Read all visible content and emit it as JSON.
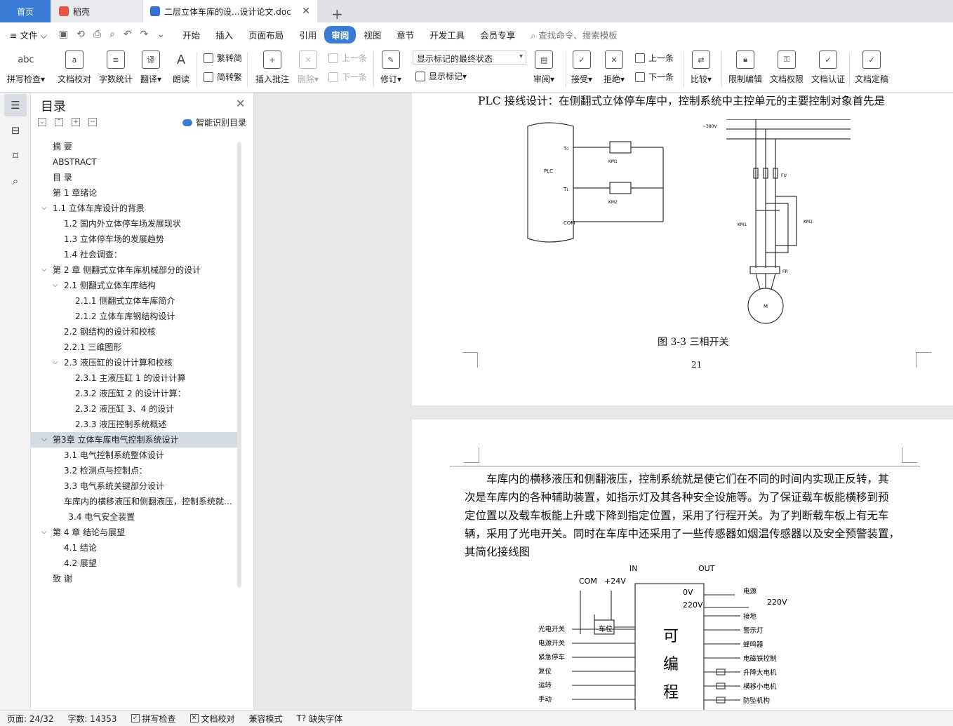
{
  "tabs": {
    "home": "首页",
    "daoke": "稻壳",
    "doc": "二层立体车库的设...设计论文.doc"
  },
  "menubar": {
    "file": "文件",
    "items": [
      "开始",
      "插入",
      "页面布局",
      "引用",
      "审阅",
      "视图",
      "章节",
      "开发工具",
      "会员专享"
    ],
    "active": "审阅",
    "search_placeholder": "查找命令、搜索模板"
  },
  "ribbon": {
    "spell": "拼写检查",
    "proof": "文档校对",
    "wordcount": "字数统计",
    "translate": "翻译",
    "read": "朗读",
    "trad": "繁转简",
    "simp": "简转繁",
    "comment": "插入批注",
    "delete": "删除",
    "prev1": "上一条",
    "next1": "下一条",
    "revise": "修订",
    "markup_select": "显示标记的最终状态",
    "show_markup": "显示标记",
    "review": "审阅",
    "accept": "接受",
    "reject": "拒绝",
    "prev2": "上一条",
    "next2": "下一条",
    "compare": "比较",
    "restrict": "限制编辑",
    "perm": "文档权限",
    "cert": "文档认证",
    "final": "文档定稿",
    "abc": "abc"
  },
  "nav": {
    "title": "目录",
    "smart": "智能识别目录",
    "items": [
      {
        "text": "摘  要",
        "level": 0,
        "chev": ""
      },
      {
        "text": "ABSTRACT",
        "level": 0,
        "chev": ""
      },
      {
        "text": "目   录",
        "level": 0,
        "chev": ""
      },
      {
        "text": "第 1 章绪论",
        "level": 0,
        "chev": ""
      },
      {
        "text": "1.1  立体车库设计的背景",
        "level": 0,
        "chev": "v"
      },
      {
        "text": "1.2  国内外立体停车场发展现状",
        "level": 1,
        "chev": ""
      },
      {
        "text": "1.3  立体停车场的发展趋势",
        "level": 1,
        "chev": ""
      },
      {
        "text": "1.4  社会调查：",
        "level": 1,
        "chev": ""
      },
      {
        "text": "第 2 章  侧翻式立体车库机械部分的设计",
        "level": 0,
        "chev": "v"
      },
      {
        "text": "2.1  侧翻式立体车库结构",
        "level": 1,
        "chev": "v"
      },
      {
        "text": "2.1.1  侧翻式立体车库简介",
        "level": 2,
        "chev": ""
      },
      {
        "text": "2.1.2    立体车库钢结构设计",
        "level": 2,
        "chev": ""
      },
      {
        "text": "2.2  钢结构的设计和校核",
        "level": 1,
        "chev": ""
      },
      {
        "text": "2.2.1  三维图形",
        "level": 1,
        "chev": ""
      },
      {
        "text": "2.3  液压缸的设计计算和校核",
        "level": 1,
        "chev": "v"
      },
      {
        "text": "2.3.1 主液压缸 1 的设计计算",
        "level": 2,
        "chev": ""
      },
      {
        "text": "2.3.2 液压缸 2 的设计计算：",
        "level": 2,
        "chev": ""
      },
      {
        "text": "2.3.2  液压缸 3、4 的设计",
        "level": 2,
        "chev": ""
      },
      {
        "text": "2.3.3  液压控制系统概述",
        "level": 2,
        "chev": ""
      },
      {
        "text": "第3章  立体车库电气控制系统设计",
        "level": 0,
        "chev": "v",
        "selected": true
      },
      {
        "text": "3.1  电气控制系统整体设计",
        "level": 1,
        "chev": ""
      },
      {
        "text": "3.2  检测点与控制点：",
        "level": 1,
        "chev": ""
      },
      {
        "text": "3.3  电气系统关键部分设计",
        "level": 1,
        "chev": ""
      },
      {
        "text": "车库内的横移液压和侧翻液压，控制系统就是使它们在不同的时间内实现正反转，其次是车库内的各种辅助装置",
        "level": 1,
        "chev": ""
      },
      {
        "text": "3.4 电气安全装置",
        "level": 1.4,
        "chev": ""
      },
      {
        "text": "第 4 章  结论与展望",
        "level": 0,
        "chev": "v"
      },
      {
        "text": "4.1    结论",
        "level": 1,
        "chev": ""
      },
      {
        "text": "4.2    展望",
        "level": 1,
        "chev": ""
      },
      {
        "text": "致    谢",
        "level": 0,
        "chev": ""
      }
    ]
  },
  "page1": {
    "heading_line": "PLC 接线设计：在侧翻式立体停车库中，控制系统中主控单元的主要控制对象首先是",
    "caption": "图 3-3  三相开关",
    "page_number": "21",
    "fig_left": {
      "plc": "PLC",
      "t0": "T₀",
      "t1": "T₁",
      "com": "COM",
      "km1": "KM1",
      "km2": "KM2"
    },
    "fig_right": {
      "v380": "~380V",
      "fu": "FU",
      "km1": "KM1",
      "km2": "KM2",
      "fr": "FR",
      "m": "M"
    }
  },
  "page2": {
    "para": [
      "车库内的横移液压和侧翻液压，控制系统就是使它们在不同的时间内实现正反转，其",
      "次是车库内的各种辅助装置，如指示灯及其各种安全设施等。为了保证载车板能横移到预",
      "定位置以及载车板能上升或下降到指定位置，采用了行程开关。为了判断载车板上有无车",
      "辆，采用了光电开关。同时在车库中还采用了一些传感器如烟温传感器以及安全预警装置，",
      "其简化接线图"
    ],
    "wiring": {
      "in": "IN",
      "out": "OUT",
      "com": "COM",
      "p24": "+24V",
      "ov": "0V",
      "v220": "220V",
      "v220b": "220V",
      "chewei": "车位",
      "inputs": [
        "光电开关",
        "电源开关",
        "紧急停车",
        "复位",
        "运转",
        "手动"
      ],
      "outputs": [
        "电源",
        "接地",
        "警示灯",
        "蜂鸣器",
        "电磁铁控制",
        "升降大电机",
        "横移小电机",
        "防坠机构"
      ],
      "plc_chars": [
        "可",
        "编",
        "程"
      ]
    }
  },
  "status": {
    "page": "页面: 24/32",
    "words": "字数: 14353",
    "spell": "拼写检查",
    "proof": "文档校对",
    "compat": "兼容模式",
    "missing_font": "缺失字体"
  }
}
